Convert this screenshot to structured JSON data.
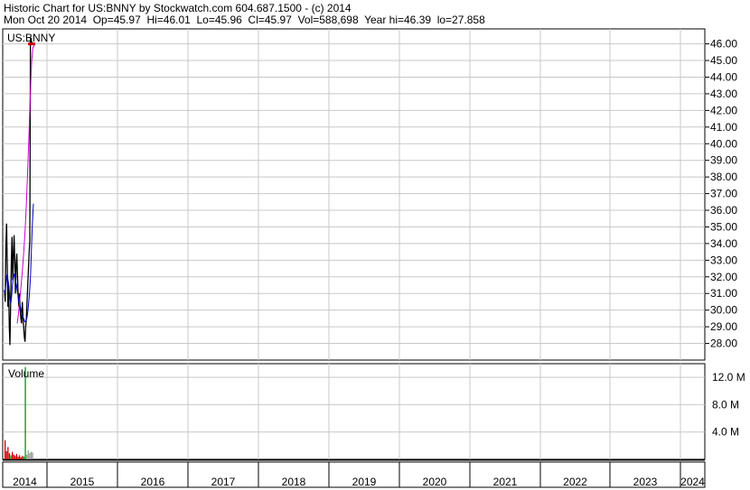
{
  "header": {
    "line1": "Historic Chart for US:BNNY by Stockwatch.com 604.687.1500 - (c) 2014",
    "line2": "Mon Oct 20 2014  Op=45.97  Hi=46.01  Lo=45.96  Cl=45.97  Vol=588,698  Year hi=46.39  lo=27.858"
  },
  "colors": {
    "price": "#000000",
    "ma_short": "#0000cc",
    "ma_long": "#cc00cc",
    "vol_down": "#cc0000",
    "vol_up": "#009900",
    "vol_flat": "#999999",
    "grid": "#c8c8c8"
  },
  "chart_data": [
    {
      "type": "line",
      "label": "US:BNNY",
      "x_labels": [
        "2014",
        "2015",
        "2016",
        "2017",
        "2018",
        "2019",
        "2020",
        "2021",
        "2022",
        "2023",
        "2024"
      ],
      "ylim": [
        27.0,
        46.9
      ],
      "y_ticks": [
        "46.00",
        "45.00",
        "44.00",
        "43.00",
        "42.00",
        "41.00",
        "40.00",
        "39.00",
        "38.00",
        "37.00",
        "36.00",
        "35.00",
        "34.00",
        "33.00",
        "32.00",
        "31.00",
        "30.00",
        "29.00",
        "28.00"
      ],
      "grid": true,
      "series": [
        {
          "values": [
            31.2,
            30.5,
            33.8,
            35.2,
            32.8,
            30.2,
            31.5,
            29.0,
            27.9,
            30.5,
            33.0,
            34.4,
            31.8,
            33.2,
            34.5,
            33.0,
            31.0,
            32.8,
            33.4,
            32.0,
            30.9,
            30.2,
            31.0,
            30.0,
            29.5,
            29.2,
            30.5,
            29.6,
            29.0,
            28.4,
            28.1,
            29.0,
            29.5,
            30.6,
            31.5,
            32.5,
            33.4,
            34.2,
            46.39,
            46.2,
            46.1,
            45.97
          ]
        },
        {
          "values": [
            31.0,
            31.2,
            31.6,
            32.0,
            32.2,
            31.8,
            31.5,
            31.0,
            30.6,
            30.4,
            30.8,
            31.4,
            31.8,
            32.0,
            32.2,
            32.0,
            31.7,
            31.5,
            31.2,
            30.9,
            30.6,
            30.4,
            30.3,
            30.1,
            29.9,
            29.7,
            29.6,
            29.5,
            29.4,
            29.3,
            29.3,
            29.4,
            29.6,
            29.9,
            30.3,
            30.8,
            31.4,
            32.2,
            33.5,
            34.6,
            35.6,
            36.4
          ]
        },
        {
          "values": [
            29.2,
            29.8,
            30.6,
            31.5,
            32.4,
            33.5,
            34.8,
            36.4,
            38.5,
            40.8,
            43.0,
            45.0,
            45.8,
            45.9
          ]
        }
      ]
    },
    {
      "type": "bar",
      "label": "Volume",
      "y_ticks": [
        "12.0 M",
        "8.0 M",
        "4.0 M"
      ],
      "ylim": [
        0,
        14000000
      ],
      "values": [
        2800000,
        1200000,
        1800000,
        900000,
        600000,
        1100000,
        700000,
        500000,
        800000,
        400000,
        600000,
        300000,
        500000,
        400000,
        13500000,
        700000,
        1300000,
        900000,
        1100000,
        1000000
      ],
      "bar_colors": [
        "#cc0000",
        "#cc0000",
        "#cc0000",
        "#cc0000",
        "#009900",
        "#cc0000",
        "#cc0000",
        "#cc0000",
        "#cc0000",
        "#cc0000",
        "#cc0000",
        "#cc0000",
        "#cc0000",
        "#009900",
        "#009900",
        "#999999",
        "#999999",
        "#999999",
        "#999999",
        "#999999"
      ]
    }
  ]
}
